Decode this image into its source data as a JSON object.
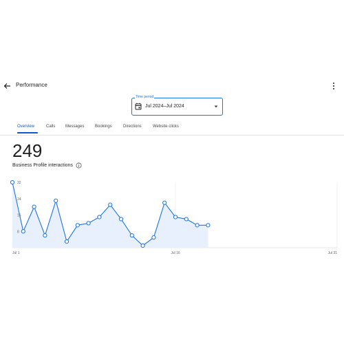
{
  "header": {
    "title": "Performance"
  },
  "time_period": {
    "label": "Time period",
    "value": "Jul 2024–Jul 2024"
  },
  "tabs": [
    {
      "label": "Overview",
      "active": true
    },
    {
      "label": "Calls",
      "active": false
    },
    {
      "label": "Messages",
      "active": false
    },
    {
      "label": "Bookings",
      "active": false
    },
    {
      "label": "Directions",
      "active": false
    },
    {
      "label": "Website clicks",
      "active": false
    }
  ],
  "summary": {
    "value": "249",
    "label": "Business Profile interactions"
  },
  "colors": {
    "accent": "#1a73e8",
    "fill": "#e8f0fe"
  },
  "chart_data": {
    "type": "area",
    "x_labels": [
      "Jul 1",
      "Jul 16",
      "Jul 31"
    ],
    "y_ticks": [
      "32",
      "24",
      "16",
      "8"
    ],
    "ylim": [
      0,
      32
    ],
    "x": [
      1,
      2,
      3,
      4,
      5,
      6,
      7,
      8,
      9,
      10,
      11,
      12,
      13,
      14,
      15,
      16,
      17,
      18,
      19
    ],
    "values": [
      32,
      8,
      20,
      6,
      23,
      3,
      11,
      12,
      15,
      21,
      14,
      6,
      1,
      5,
      22,
      15,
      14,
      11,
      11
    ]
  }
}
